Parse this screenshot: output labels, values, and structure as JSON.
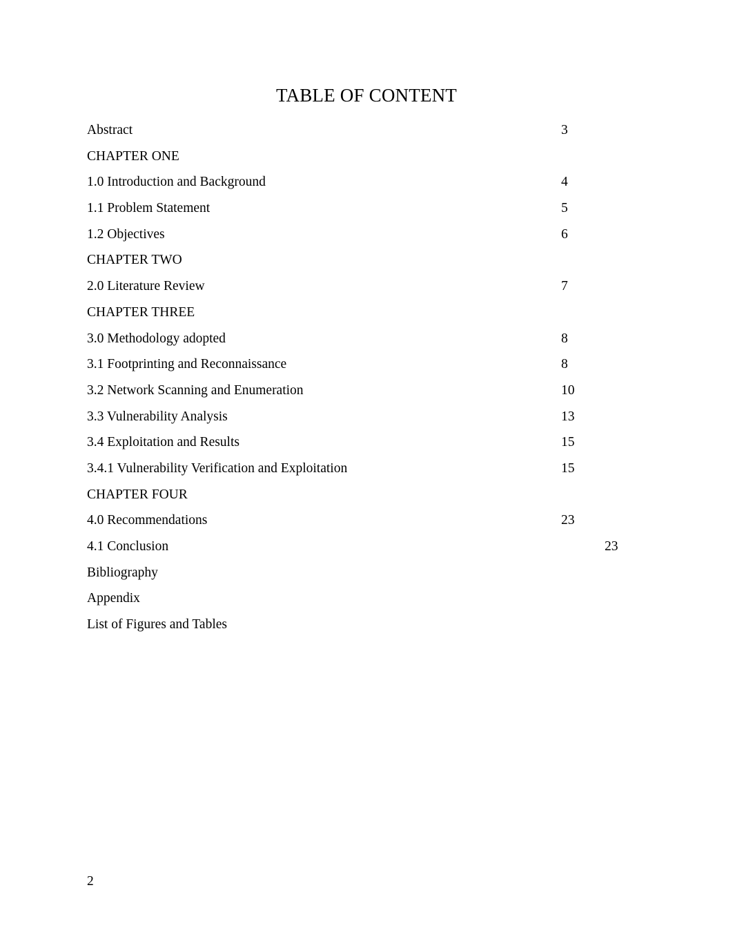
{
  "document": {
    "title": "TABLE OF CONTENT",
    "folio": "2"
  },
  "toc": {
    "entries": [
      {
        "label": "Abstract",
        "page": "3",
        "shifted": false
      },
      {
        "label": "CHAPTER ONE",
        "page": "",
        "shifted": false
      },
      {
        "label": "1.0 Introduction and Background",
        "page": "4",
        "shifted": false
      },
      {
        "label": "1.1 Problem Statement",
        "page": "5",
        "shifted": false
      },
      {
        "label": "1.2 Objectives",
        "page": "6",
        "shifted": false
      },
      {
        "label": "CHAPTER TWO",
        "page": "",
        "shifted": false
      },
      {
        "label": "2.0 Literature Review",
        "page": "7",
        "shifted": false
      },
      {
        "label": "CHAPTER THREE",
        "page": "",
        "shifted": false
      },
      {
        "label": "3.0 Methodology adopted",
        "page": "8",
        "shifted": false
      },
      {
        "label": "3.1 Footprinting and Reconnaissance",
        "page": "8",
        "shifted": false
      },
      {
        "label": "3.2 Network Scanning and Enumeration",
        "page": "10",
        "shifted": false
      },
      {
        "label": "3.3 Vulnerability Analysis",
        "page": "13",
        "shifted": false
      },
      {
        "label": "3.4 Exploitation and Results",
        "page": "15",
        "shifted": false
      },
      {
        "label": "3.4.1 Vulnerability Verification and Exploitation",
        "page": "15",
        "shifted": false
      },
      {
        "label": "CHAPTER FOUR",
        "page": "",
        "shifted": false
      },
      {
        "label": "4.0 Recommendations",
        "page": "23",
        "shifted": false
      },
      {
        "label": "4.1 Conclusion",
        "page": "23",
        "shifted": true
      },
      {
        "label": "Bibliography",
        "page": "",
        "shifted": false
      },
      {
        "label": "Appendix",
        "page": "",
        "shifted": false
      },
      {
        "label": "List of Figures and Tables",
        "page": "",
        "shifted": false
      }
    ]
  }
}
